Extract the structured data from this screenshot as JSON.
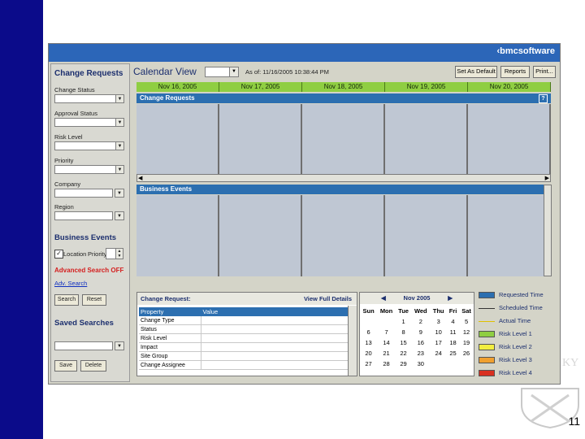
{
  "app": {
    "brand": "‹bmcsoftware"
  },
  "slide": {
    "number": "11"
  },
  "left_panel": {
    "change_requests_title": "Change Requests",
    "fields": [
      {
        "label": "Change Status",
        "value": ""
      },
      {
        "label": "Approval Status",
        "value": ""
      },
      {
        "label": "Risk Level",
        "value": ""
      },
      {
        "label": "Priority",
        "value": ""
      },
      {
        "label": "Company",
        "value": ""
      },
      {
        "label": "Region",
        "value": ""
      }
    ],
    "business_events_title": "Business Events",
    "location_label": "Location",
    "priority_label": "Priority",
    "advanced_search": "Advanced Search OFF",
    "adv_search_link": "Adv. Search",
    "search_btn": "Search",
    "reset_btn": "Reset",
    "saved_searches_title": "Saved Searches",
    "save_btn": "Save",
    "delete_btn": "Delete"
  },
  "toolbar": {
    "title": "Calendar View",
    "as_of": "As of: 11/16/2005 10:38:44 PM",
    "set_default": "Set As Default",
    "reports": "Reports",
    "print": "Print..."
  },
  "dates": [
    "Nov 16, 2005",
    "Nov 17, 2005",
    "Nov 18, 2005",
    "Nov 19, 2005",
    "Nov 20, 2005"
  ],
  "sections": {
    "change_requests": "Change Requests",
    "business_events": "Business Events"
  },
  "details": {
    "title": "Change Request:",
    "view_full": "View Full Details",
    "col_property": "Property",
    "col_value": "Value",
    "rows": [
      "Change Type",
      "Status",
      "Risk Level",
      "Impact",
      "Site Group",
      "Change Assignee"
    ]
  },
  "mini_calendar": {
    "month": "Nov 2005",
    "days": [
      "Sun",
      "Mon",
      "Tue",
      "Wed",
      "Thu",
      "Fri",
      "Sat"
    ],
    "weeks": [
      [
        "",
        "",
        "1",
        "2",
        "3",
        "4",
        "5"
      ],
      [
        "6",
        "7",
        "8",
        "9",
        "10",
        "11",
        "12"
      ],
      [
        "13",
        "14",
        "15",
        "16",
        "17",
        "18",
        "19"
      ],
      [
        "20",
        "21",
        "22",
        "23",
        "24",
        "25",
        "26"
      ],
      [
        "27",
        "28",
        "29",
        "30",
        "",
        "",
        ""
      ]
    ]
  },
  "legend": [
    {
      "label": "Requested Time",
      "color": "#2c6fb0",
      "kind": "box"
    },
    {
      "label": "Scheduled Time",
      "color": "#333333",
      "kind": "line"
    },
    {
      "label": "Actual Time",
      "color": "#e0c000",
      "kind": "line"
    },
    {
      "label": "Risk Level 1",
      "color": "#8fce42",
      "kind": "box"
    },
    {
      "label": "Risk Level 2",
      "color": "#f2ee40",
      "kind": "box"
    },
    {
      "label": "Risk Level 3",
      "color": "#f0a030",
      "kind": "box"
    },
    {
      "label": "Risk Level 4",
      "color": "#d83020",
      "kind": "box"
    }
  ]
}
